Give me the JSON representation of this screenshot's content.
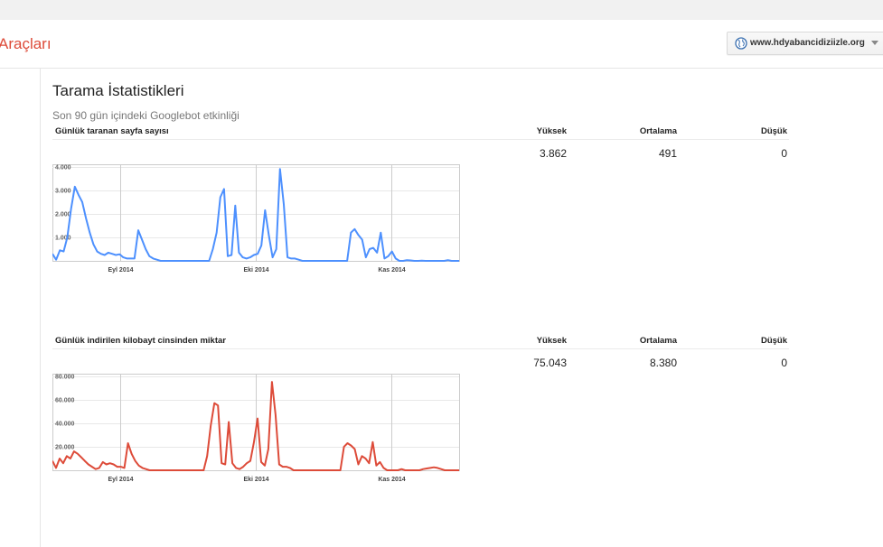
{
  "header": {
    "app_title": "Araçları",
    "site": "www.hdyabancidiziizle.org",
    "globe_icon": "globe-icon",
    "caret_icon": "chevron-down-icon"
  },
  "page": {
    "title": "Tarama İstatistikleri",
    "subtitle": "Son 90 gün içindeki Googlebot etkinliği"
  },
  "columns": {
    "high": "Yüksek",
    "avg": "Ortalama",
    "low": "Düşük"
  },
  "sections": [
    {
      "label": "Günlük taranan sayfa sayısı",
      "high": "3.862",
      "avg": "491",
      "low": "0",
      "color": "#4d90fe"
    },
    {
      "label": "Günlük indirilen kilobayt cinsinden miktar",
      "high": "75.043",
      "avg": "8.380",
      "low": "0",
      "color": "#dd4b39"
    }
  ],
  "chart_data": [
    {
      "type": "line",
      "title": "",
      "x_tick_labels": [
        "Eyl 2014",
        "Eki 2014",
        "Kas 2014"
      ],
      "x_tick_positions": [
        15,
        45,
        75
      ],
      "y_tick_labels": [
        "1.000",
        "2.000",
        "3.000",
        "4.000"
      ],
      "y_tick_values": [
        1000,
        2000,
        3000,
        4000
      ],
      "ylim": [
        0,
        4100
      ],
      "grid": true,
      "series": [
        {
          "color": "#4d90fe",
          "values": [
            300,
            50,
            450,
            400,
            1000,
            2200,
            3150,
            2800,
            2500,
            1800,
            1200,
            700,
            400,
            300,
            250,
            350,
            300,
            250,
            280,
            150,
            100,
            100,
            100,
            1300,
            900,
            500,
            200,
            100,
            50,
            0,
            0,
            0,
            0,
            0,
            0,
            0,
            0,
            0,
            0,
            0,
            0,
            0,
            0,
            500,
            1200,
            2700,
            3050,
            200,
            250,
            2350,
            350,
            150,
            100,
            150,
            250,
            300,
            650,
            2150,
            1100,
            150,
            500,
            3900,
            2400,
            150,
            100,
            100,
            50,
            0,
            0,
            0,
            0,
            0,
            0,
            0,
            0,
            0,
            0,
            0,
            0,
            0,
            1200,
            1350,
            1100,
            900,
            150,
            500,
            550,
            350,
            1200,
            100,
            200,
            400,
            100,
            0,
            0,
            30,
            20,
            0,
            0,
            10,
            0,
            0,
            0,
            0,
            0,
            0,
            30,
            0,
            0,
            0
          ]
        }
      ]
    },
    {
      "type": "line",
      "title": "",
      "x_tick_labels": [
        "Eyl 2014",
        "Eki 2014",
        "Kas 2014"
      ],
      "x_tick_positions": [
        15,
        45,
        75
      ],
      "y_tick_labels": [
        "20.000",
        "40.000",
        "60.000",
        "80.000"
      ],
      "y_tick_values": [
        20000,
        40000,
        60000,
        80000
      ],
      "ylim": [
        0,
        82000
      ],
      "grid": true,
      "series": [
        {
          "color": "#dd4b39",
          "values": [
            8000,
            2000,
            10000,
            6000,
            12000,
            10000,
            16000,
            14000,
            11000,
            8000,
            5000,
            3000,
            1000,
            2000,
            7000,
            5000,
            6000,
            5000,
            3000,
            3000,
            2000,
            23000,
            14000,
            8000,
            4000,
            2000,
            1000,
            0,
            0,
            0,
            0,
            0,
            0,
            0,
            0,
            0,
            0,
            0,
            0,
            0,
            0,
            0,
            0,
            12000,
            38000,
            57000,
            55000,
            6000,
            5000,
            41000,
            6000,
            2000,
            1000,
            3000,
            6000,
            8000,
            24000,
            44000,
            7000,
            4000,
            18000,
            75000,
            47000,
            5000,
            3000,
            3000,
            2000,
            0,
            0,
            0,
            0,
            0,
            0,
            0,
            0,
            0,
            0,
            0,
            0,
            0,
            0,
            20000,
            23000,
            21000,
            18000,
            5000,
            12000,
            10000,
            6000,
            24000,
            4000,
            7000,
            2000,
            0,
            0,
            0,
            0,
            1000,
            0,
            0,
            0,
            0,
            0,
            1000,
            1500,
            2000,
            2500,
            2000,
            1000,
            0,
            0,
            0,
            0,
            0
          ]
        }
      ]
    }
  ]
}
